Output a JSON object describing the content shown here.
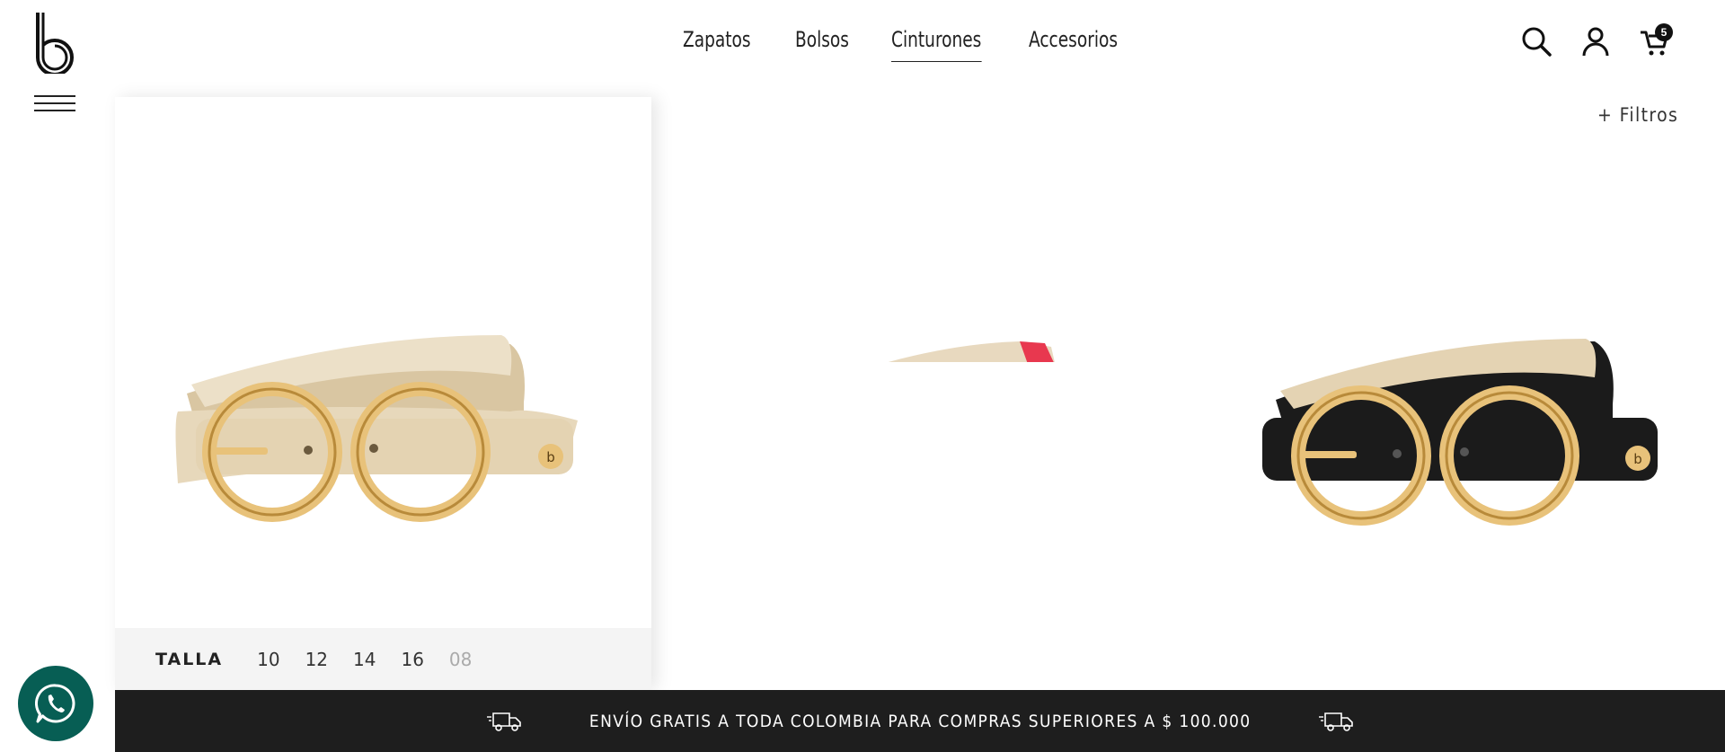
{
  "brand": {
    "logo_icon": "brand-b-logo-icon"
  },
  "nav": {
    "items": [
      {
        "label": "Zapatos",
        "active": false
      },
      {
        "label": "Bolsos",
        "active": false
      },
      {
        "label": "Cinturones",
        "active": true
      },
      {
        "label": "Accesorios",
        "active": false
      }
    ]
  },
  "header_icons": {
    "search": "search-icon",
    "account": "user-icon",
    "cart": "cart-icon",
    "cart_count": "5"
  },
  "filters": {
    "label": "+ Filtros"
  },
  "product_card": {
    "size_label": "TALLA",
    "sizes": [
      {
        "value": "10",
        "available": true
      },
      {
        "value": "12",
        "available": true
      },
      {
        "value": "14",
        "available": true
      },
      {
        "value": "16",
        "available": true
      },
      {
        "value": "08",
        "available": false
      }
    ]
  },
  "promo": {
    "text": "ENVÍO GRATIS A TODA COLOMBIA PARA COMPRAS SUPERIORES A $ 100.000",
    "icon": "delivery-truck-icon"
  },
  "whatsapp": {
    "icon": "whatsapp-icon",
    "color": "#075e54"
  },
  "colors": {
    "promo_bg": "#1e1e1e",
    "belt_beige": "#e9dcc2",
    "belt_black": "#1b1b1b",
    "buckle_gold": "#e8c27a"
  }
}
